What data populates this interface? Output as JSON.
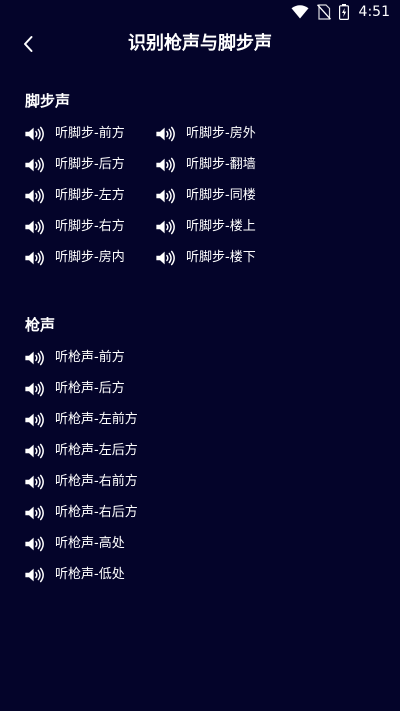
{
  "status_bar": {
    "time": "4:51",
    "icons": [
      "wifi-icon",
      "no-sim-icon",
      "battery-charging-icon"
    ]
  },
  "header": {
    "title": "识别枪声与脚步声",
    "back_icon": "back-chevron-icon"
  },
  "footsteps": {
    "title": "脚步声",
    "items": [
      "听脚步-前方",
      "听脚步-房外",
      "听脚步-后方",
      "听脚步-翻墙",
      "听脚步-左方",
      "听脚步-同楼",
      "听脚步-右方",
      "听脚步-楼上",
      "听脚步-房内",
      "听脚步-楼下"
    ]
  },
  "gunshots": {
    "title": "枪声",
    "items": [
      "听枪声-前方",
      "听枪声-后方",
      "听枪声-左前方",
      "听枪声-左后方",
      "听枪声-右前方",
      "听枪声-右后方",
      "听枪声-高处",
      "听枪声-低处"
    ]
  },
  "item_icon": "speaker-icon",
  "colors": {
    "background": "#04042a",
    "text": "#ffffff"
  }
}
